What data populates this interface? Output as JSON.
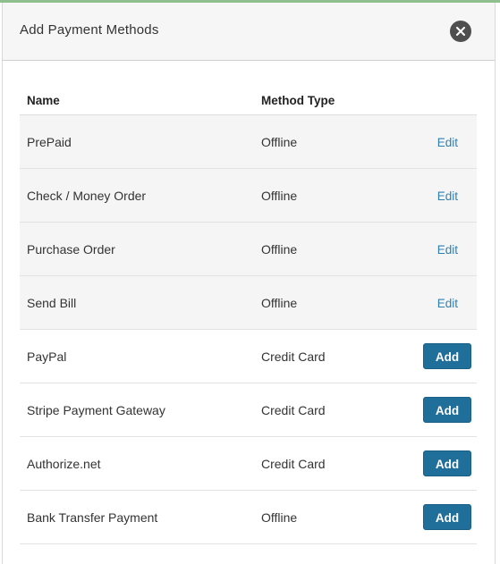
{
  "modal": {
    "title": "Add Payment Methods",
    "close_icon": "close-icon"
  },
  "table": {
    "headers": {
      "name": "Name",
      "method_type": "Method Type"
    },
    "rows": [
      {
        "name": "PrePaid",
        "method_type": "Offline",
        "action": "Edit",
        "action_kind": "edit"
      },
      {
        "name": "Check / Money Order",
        "method_type": "Offline",
        "action": "Edit",
        "action_kind": "edit"
      },
      {
        "name": "Purchase Order",
        "method_type": "Offline",
        "action": "Edit",
        "action_kind": "edit"
      },
      {
        "name": "Send Bill",
        "method_type": "Offline",
        "action": "Edit",
        "action_kind": "edit"
      },
      {
        "name": "PayPal",
        "method_type": "Credit Card",
        "action": "Add",
        "action_kind": "add"
      },
      {
        "name": "Stripe Payment Gateway",
        "method_type": "Credit Card",
        "action": "Add",
        "action_kind": "add"
      },
      {
        "name": "Authorize.net",
        "method_type": "Credit Card",
        "action": "Add",
        "action_kind": "add"
      },
      {
        "name": "Bank Transfer Payment",
        "method_type": "Offline",
        "action": "Add",
        "action_kind": "add"
      }
    ]
  },
  "colors": {
    "edit_link": "#2f7fb0",
    "add_button": "#1f6f9a",
    "shaded_row": "#f5f5f5",
    "close_button": "#4f4f4f"
  }
}
